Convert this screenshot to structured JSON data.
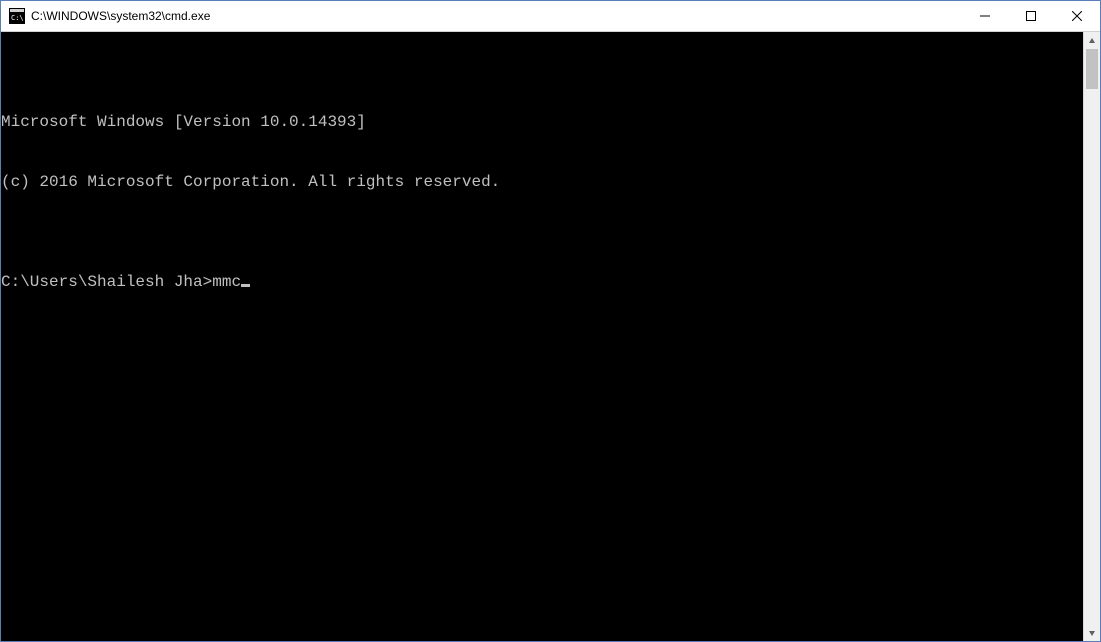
{
  "window": {
    "title": "C:\\WINDOWS\\system32\\cmd.exe"
  },
  "console": {
    "line1": "Microsoft Windows [Version 10.0.14393]",
    "line2": "(c) 2016 Microsoft Corporation. All rights reserved.",
    "blank": "",
    "prompt": "C:\\Users\\Shailesh Jha>",
    "command": "mmc"
  }
}
